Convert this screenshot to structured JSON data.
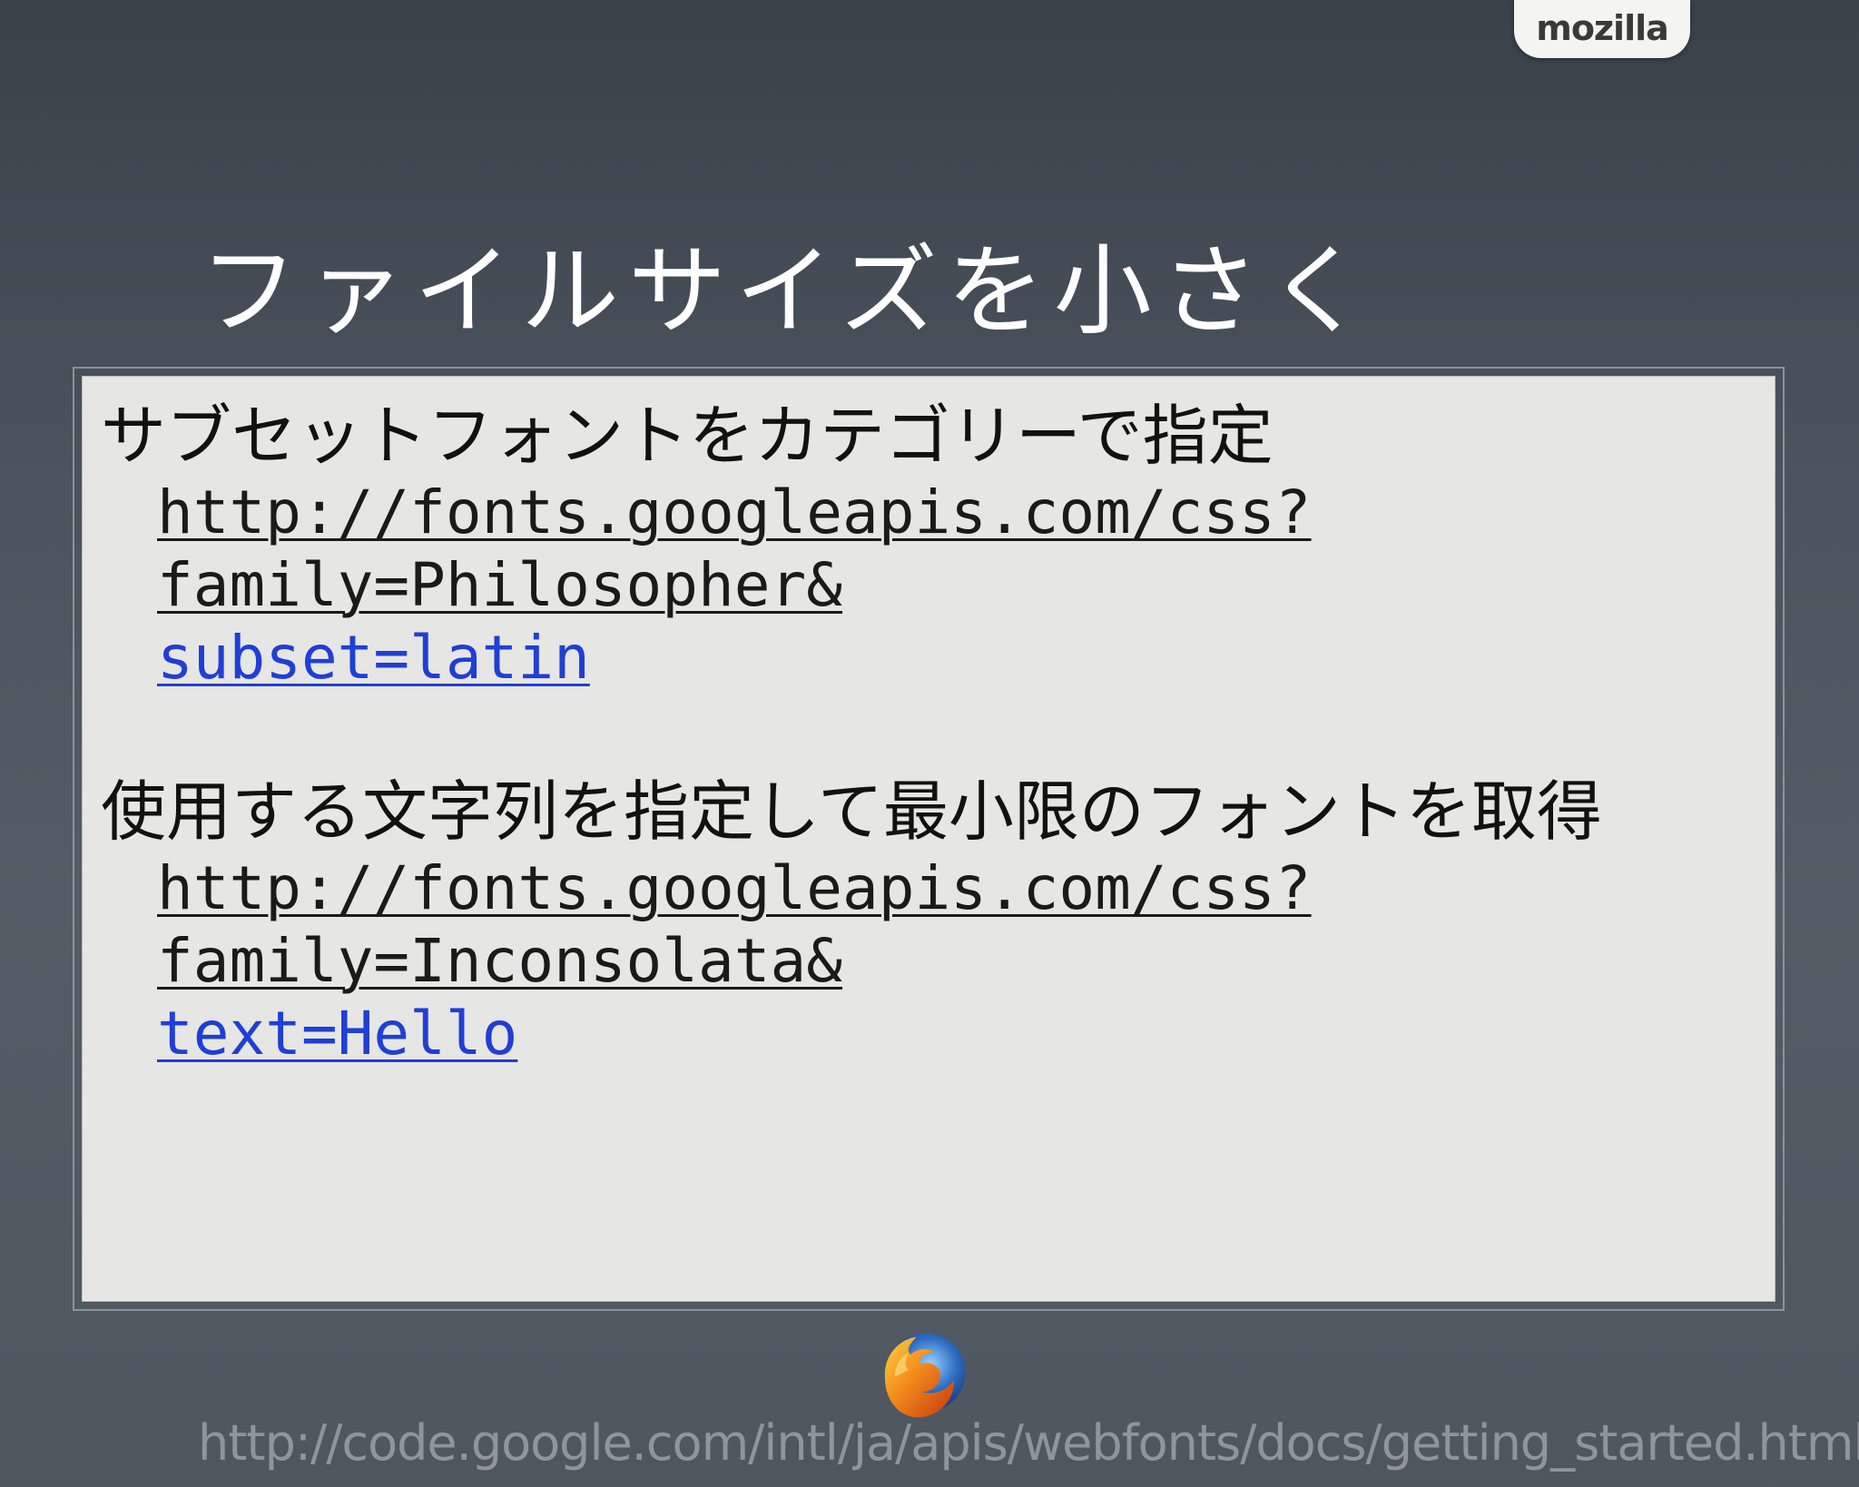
{
  "brand": {
    "tab_label": "mozilla",
    "logo_icon": "firefox-logo-icon"
  },
  "slide": {
    "title": "ファイルサイズを小さく"
  },
  "sections": [
    {
      "heading": "サブセットフォントをカテゴリーで指定",
      "url_lines": [
        "http://fonts.googleapis.com/css?",
        "family=Philosopher&",
        "subset=latin"
      ]
    },
    {
      "heading": "使用する文字列を指定して最小限のフォントを取得",
      "url_lines": [
        "http://fonts.googleapis.com/css?",
        "family=Inconsolata&",
        "text=Hello"
      ]
    }
  ],
  "footer": {
    "source_url": "http://code.google.com/intl/ja/apis/webfonts/docs/getting_started.html"
  },
  "colors": {
    "background": "#4a535d",
    "panel": "#e6e6e4",
    "link_blue": "#1f3fd6",
    "text_dark": "#111111",
    "footer_text": "#8e959d"
  }
}
